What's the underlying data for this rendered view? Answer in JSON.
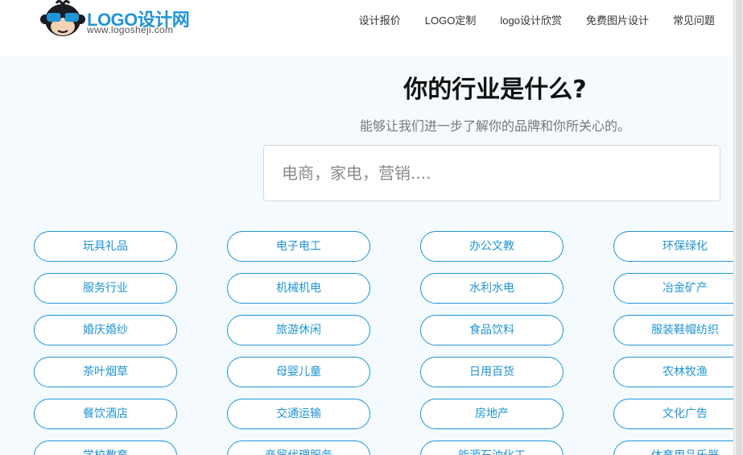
{
  "header": {
    "logo_text": "LOGO设计网",
    "logo_url": "www.logosheji.com",
    "nav": [
      "设计报价",
      "LOGO定制",
      "logo设计欣赏",
      "免费图片设计",
      "常见问题"
    ]
  },
  "hero": {
    "title": "你的行业是什么?",
    "subtitle": "能够让我们进一步了解你的品牌和你所关心的。",
    "search_placeholder": "电商，家电，营销...."
  },
  "industries": [
    "玩具礼品",
    "电子电工",
    "办公文教",
    "环保绿化",
    "服务行业",
    "机械机电",
    "水利水电",
    "冶金矿产",
    "婚庆婚纱",
    "旅游休闲",
    "食品饮料",
    "服装鞋帽纺织",
    "茶叶烟草",
    "母婴儿童",
    "日用百货",
    "农林牧渔",
    "餐饮酒店",
    "交通运输",
    "房地产",
    "文化广告",
    "学校教育",
    "商贸代理服务",
    "能源石油化工",
    "体育用品乐器"
  ],
  "colors": {
    "accent": "#1f95d6",
    "page_bg": "#f4fafd",
    "header_bg": "#ffffff"
  },
  "icons": {
    "logo_mascot": "monkey-sunglasses-icon"
  }
}
